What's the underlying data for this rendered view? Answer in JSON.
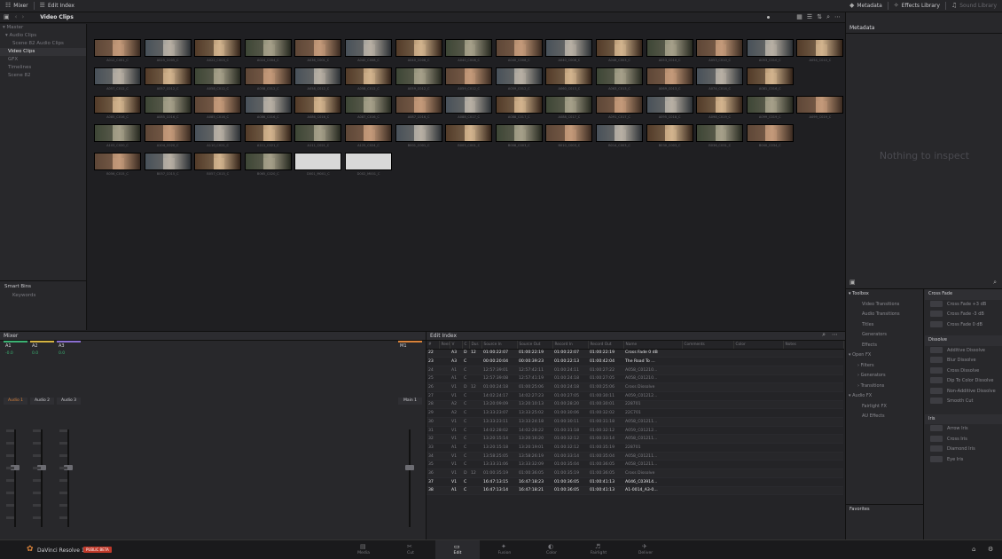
{
  "topbar": {
    "mixer": "Mixer",
    "edit_index": "Edit Index",
    "metadata": "Metadata",
    "effects_library": "Effects Library",
    "sound_library": "Sound Library"
  },
  "pool": {
    "title": "Video Clips"
  },
  "inspector": {
    "title": "Metadata",
    "empty": "Nothing to inspect"
  },
  "sidebar": {
    "items": [
      "Master",
      "Audio Clips",
      "Scene 82 Audio Clips",
      "Video Clips",
      "GFX",
      "Timelines",
      "Scene 82"
    ],
    "smart_bins": "Smart Bins",
    "keywords": "Keywords"
  },
  "clips": [
    [
      "A012_C001_C",
      "A025_C005_C",
      "A022_C003_C",
      "A024_C004_C",
      "A036_C001_C",
      "A040_C008_C",
      "A040_C008_C",
      "A040_C008_C",
      "A040_C008_C",
      "A040_C008_C",
      "A046_C003_C",
      "A053_C010_C",
      "A053_C010_C",
      "A053_C010_C",
      "A054_C010_C"
    ],
    [
      "A057_C012_C",
      "A057_C012_C",
      "A058_C012_C",
      "A058_C012_C",
      "A058_C012_C",
      "A058_C012_C",
      "A059_C012_C",
      "A059_C012_C",
      "A059_C012_C",
      "A060_C013_C",
      "A063_C013_C",
      "A069_C013_C",
      "A074_C014_C",
      "A081_C016_C"
    ],
    [
      "A085_C016_C",
      "A085_C016_C",
      "A085_C016_C",
      "A086_C016_C",
      "A086_C016_C",
      "A087_C016_C",
      "A087_C016_C",
      "A088_C017_C",
      "A088_C017_C",
      "A088_C017_C",
      "A091_C017_C",
      "A095_C018_C",
      "A098_C019_C",
      "A099_C019_C",
      "A099_C019_C"
    ],
    [
      "A103_C020_C",
      "A104_C020_C",
      "A110_C021_C",
      "A111_C021_C",
      "A111_C021_C",
      "A125_C024_C",
      "B001_C001_C",
      "B005_C001_C",
      "B008_C003_C",
      "B010_C003_C",
      "B014_C003_C",
      "B030_C003_C",
      "B036_C031_C",
      "B040_C034_C"
    ],
    [
      "B056_C015_C",
      "B057_C015_C",
      "B057_C015_C",
      "B065_C020_C",
      "D001_M001_C",
      "D002_M001_C"
    ]
  ],
  "mixer": {
    "title": "Mixer",
    "tracks": [
      "A1",
      "A2",
      "A3"
    ],
    "master": "M1",
    "strips": [
      "Audio 1",
      "Audio 2",
      "Audio 3"
    ],
    "main": "Main 1",
    "track_values": [
      "-0.0",
      "0.0",
      "0.0"
    ]
  },
  "edit_index": {
    "title": "Edit Index",
    "columns": [
      "#",
      "Reel",
      "V",
      "C",
      "Dur.",
      "Source In",
      "Source Out",
      "Record In",
      "Record Out",
      "Name",
      "Comments",
      "Color",
      "Notes"
    ],
    "rows": [
      [
        "22",
        "",
        "A3",
        "D",
        "12",
        "01:00:22:07",
        "01:00:22:19",
        "01:00:22:07",
        "01:00:22:19",
        "Cross Fade 0 dB"
      ],
      [
        "23",
        "",
        "A3",
        "C",
        "",
        "00:00:20:04",
        "00:00:39:23",
        "01:00:22:13",
        "01:00:42:04",
        "The Road To ..."
      ],
      [
        "24",
        "",
        "A1",
        "C",
        "",
        "12:57:39:01",
        "12:57:42:11",
        "01:00:24:11",
        "01:00:27:22",
        "A058_C01210..."
      ],
      [
        "25",
        "",
        "A1",
        "C",
        "",
        "12:57:39:08",
        "12:57:41:19",
        "01:00:24:18",
        "01:00:27:05",
        "A058_C01210..."
      ],
      [
        "26",
        "",
        "V1",
        "D",
        "12",
        "01:00:24:18",
        "01:00:25:06",
        "01:00:24:18",
        "01:00:25:06",
        "Cross Dissolve"
      ],
      [
        "27",
        "",
        "V1",
        "C",
        "",
        "14:02:24:17",
        "14:02:27:23",
        "01:00:27:05",
        "01:00:30:11",
        "A059_C01212..."
      ],
      [
        "28",
        "",
        "A2",
        "C",
        "",
        "13:20:09:09",
        "13:20:10:13",
        "01:00:28:20",
        "01:00:30:01",
        "228701"
      ],
      [
        "29",
        "",
        "A2",
        "C",
        "",
        "13:33:23:07",
        "13:33:25:02",
        "01:00:30:06",
        "01:00:32:02",
        "22C701"
      ],
      [
        "30",
        "",
        "V1",
        "C",
        "",
        "13:33:23:11",
        "13:33:24:18",
        "01:00:30:11",
        "01:00:31:18",
        "A058_C01211..."
      ],
      [
        "31",
        "",
        "V1",
        "C",
        "",
        "14:02:28:02",
        "14:02:28:22",
        "01:00:31:18",
        "01:00:32:12",
        "A059_C01212..."
      ],
      [
        "32",
        "",
        "V1",
        "C",
        "",
        "13:20:15:14",
        "13:20:16:20",
        "01:00:32:12",
        "01:00:33:14",
        "A058_C01211..."
      ],
      [
        "33",
        "",
        "A1",
        "C",
        "",
        "13:20:15:18",
        "13:20:19:01",
        "01:00:32:12",
        "01:00:35:19",
        "228701"
      ],
      [
        "34",
        "",
        "V1",
        "C",
        "",
        "13:58:25:05",
        "13:58:26:19",
        "01:00:33:14",
        "01:00:35:04",
        "A058_C01211..."
      ],
      [
        "35",
        "",
        "V1",
        "C",
        "",
        "13:33:31:06",
        "13:33:32:09",
        "01:00:35:04",
        "01:00:36:05",
        "A058_C01211..."
      ],
      [
        "36",
        "",
        "V1",
        "D",
        "12",
        "01:00:35:19",
        "01:00:36:05",
        "01:00:35:19",
        "01:00:36:05",
        "Cross Dissolve"
      ],
      [
        "37",
        "",
        "V1",
        "C",
        "",
        "16:47:13:15",
        "16:47:18:23",
        "01:00:36:05",
        "01:00:41:13",
        "A046_C03914..."
      ],
      [
        "38",
        "",
        "A1",
        "C",
        "",
        "16:47:13:14",
        "16:47:18:21",
        "01:00:36:05",
        "01:00:41:13",
        "A1-0014_A3-0..."
      ]
    ]
  },
  "toolbox": {
    "header": "Toolbox",
    "items": [
      "Video Transitions",
      "Audio Transitions",
      "Titles",
      "Generators",
      "Effects"
    ],
    "openfx": "Open FX",
    "openfx_items": [
      "Filters",
      "Generators",
      "Transitions"
    ],
    "audiofx": "Audio FX",
    "audiofx_items": [
      "Fairlight FX",
      "AU Effects"
    ],
    "favorites": "Favorites"
  },
  "transitions": {
    "cross_fade": "Cross Fade",
    "cf_items": [
      "Cross Fade +3 dB",
      "Cross Fade -3 dB",
      "Cross Fade 0 dB"
    ],
    "dissolve": "Dissolve",
    "d_items": [
      "Additive Dissolve",
      "Blur Dissolve",
      "Cross Dissolve",
      "Dip To Color Dissolve",
      "Non-Additive Dissolve",
      "Smooth Cut"
    ],
    "iris": "Iris",
    "i_items": [
      "Arrow Iris",
      "Cross Iris",
      "Diamond Iris",
      "Eye Iris"
    ]
  },
  "bottombar": {
    "app": "DaVinci Resolve 17",
    "badge": "PUBLIC BETA",
    "pages": [
      "Media",
      "Cut",
      "Edit",
      "Fusion",
      "Color",
      "Fairlight",
      "Deliver"
    ],
    "active_page": "Edit"
  },
  "colors": {
    "accent_orange": "#d9823a",
    "badge_red": "#c0392b",
    "track_green": "#3bb273",
    "track_purple": "#8a6fd1",
    "track_yellow": "#d4b341"
  }
}
